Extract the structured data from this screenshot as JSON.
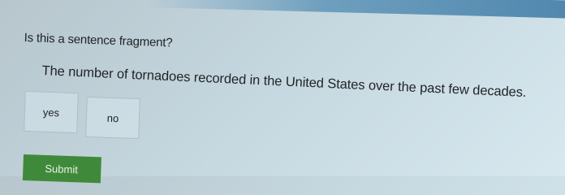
{
  "question": {
    "prompt": "Is this a sentence fragment?",
    "sentence": "The number of tornadoes recorded in the United States over the past few decades."
  },
  "choices": [
    {
      "label": "yes"
    },
    {
      "label": "no"
    }
  ],
  "submit_label": "Submit",
  "colors": {
    "background": "#c4d6de",
    "submit_button": "#3f8a3a",
    "top_band": "#4f86ad"
  }
}
